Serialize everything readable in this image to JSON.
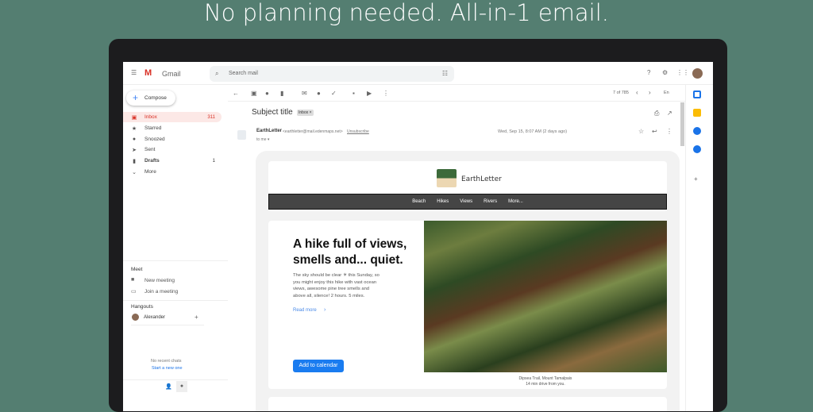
{
  "headline": "No planning needed. All-in-1 email.",
  "gmail": {
    "brand": "Gmail",
    "search_placeholder": "Search mail",
    "compose": "Compose",
    "nav": [
      {
        "label": "Inbox",
        "count": "311"
      },
      {
        "label": "Starred",
        "count": ""
      },
      {
        "label": "Snoozed",
        "count": ""
      },
      {
        "label": "Sent",
        "count": ""
      },
      {
        "label": "Drafts",
        "count": "1"
      },
      {
        "label": "More",
        "count": ""
      }
    ],
    "meet": {
      "title": "Meet",
      "new": "New meeting",
      "join": "Join a meeting"
    },
    "hangouts": {
      "title": "Hangouts",
      "user": "Alexander",
      "empty": "No recent chats",
      "start": "Start a new one"
    },
    "pager": "7 of 785",
    "lang": "En",
    "subject": "Subject title",
    "label": "Inbox ×",
    "sender": "EarthLetter",
    "sender_email": "<earthletter@mail.edenmaps.net>",
    "unsubscribe": "Unsubscribe",
    "to": "to me ▾",
    "date": "Wed, Sep 15, 8:07 AM (2 days ago)"
  },
  "newsletter": {
    "brand": "EarthLetter",
    "menu": [
      "Beach",
      "Hikes",
      "Views",
      "Rivers",
      "More..."
    ],
    "headline": "A hike full of views, smells and... quiet.",
    "body": "The sky should be clear ☀ this Sunday, so you might enjoy this hike with vast ocean views, awesome pine tree smells and above all, silence! 2 hours. 5 miles.",
    "read_more": "Read more",
    "cta": "Add to calendar",
    "caption1": "Dipsea Trail, Mount Tamalpais",
    "caption2": "14 min drive from you."
  }
}
